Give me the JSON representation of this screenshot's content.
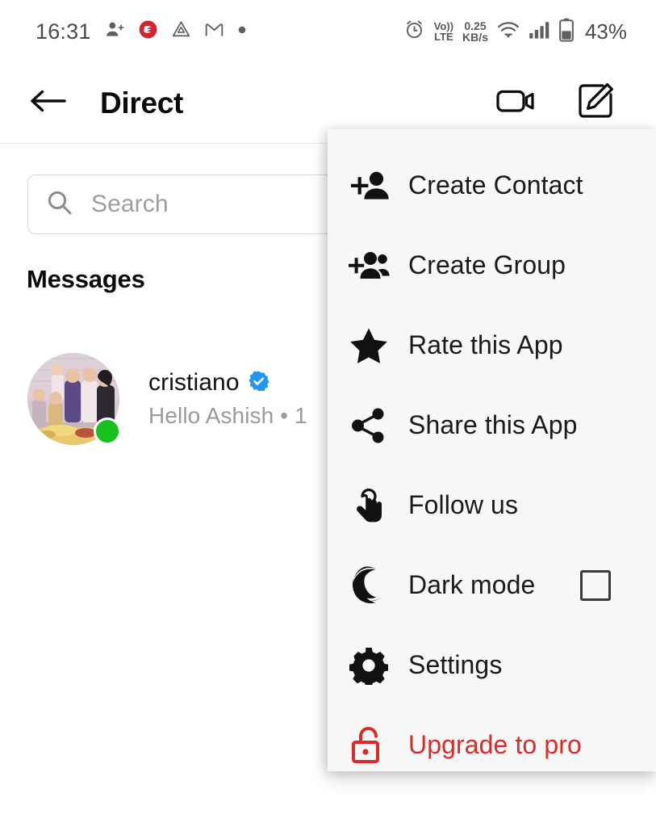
{
  "status_bar": {
    "time": "16:31",
    "left_icons": [
      "person-add-icon",
      "app-red-circle-icon",
      "drive-triangle-icon",
      "gmail-icon",
      "dot-icon"
    ],
    "alarm_icon": "alarm-icon",
    "volte_top": "Vo))",
    "volte_bottom": "LTE",
    "net_speed_value": "0.25",
    "net_speed_unit": "KB/s",
    "wifi_icon": "wifi-icon",
    "signal_icon": "cellular-signal-icon",
    "battery_icon": "battery-icon",
    "battery_percent": "43%"
  },
  "appbar": {
    "back_icon": "back-arrow-icon",
    "title": "Direct",
    "video_icon": "video-camera-icon",
    "compose_icon": "compose-edit-icon"
  },
  "search": {
    "icon": "search-icon",
    "placeholder": "Search",
    "value": ""
  },
  "messages_section": {
    "title": "Messages",
    "items": [
      {
        "avatar": "family-photo-avatar",
        "online": true,
        "name": "cristiano",
        "verified_icon": "verified-badge-icon",
        "preview": "Hello Ashish  • 1"
      }
    ]
  },
  "menu": {
    "background": "#F7F7F7",
    "danger_color": "#DB2B27",
    "items": [
      {
        "icon": "person-add-icon",
        "label": "Create Contact",
        "danger": false,
        "checkbox": null
      },
      {
        "icon": "group-add-icon",
        "label": "Create Group",
        "danger": false,
        "checkbox": null
      },
      {
        "icon": "star-icon",
        "label": "Rate this App",
        "danger": false,
        "checkbox": null
      },
      {
        "icon": "share-icon",
        "label": "Share this App",
        "danger": false,
        "checkbox": null
      },
      {
        "icon": "touch-hand-icon",
        "label": "Follow us",
        "danger": false,
        "checkbox": null
      },
      {
        "icon": "moon-icon",
        "label": "Dark mode",
        "danger": false,
        "checkbox": "unchecked"
      },
      {
        "icon": "gear-icon",
        "label": "Settings",
        "danger": false,
        "checkbox": null
      },
      {
        "icon": "unlock-padlock-icon",
        "label": "Upgrade to pro",
        "danger": true,
        "checkbox": null
      }
    ]
  }
}
